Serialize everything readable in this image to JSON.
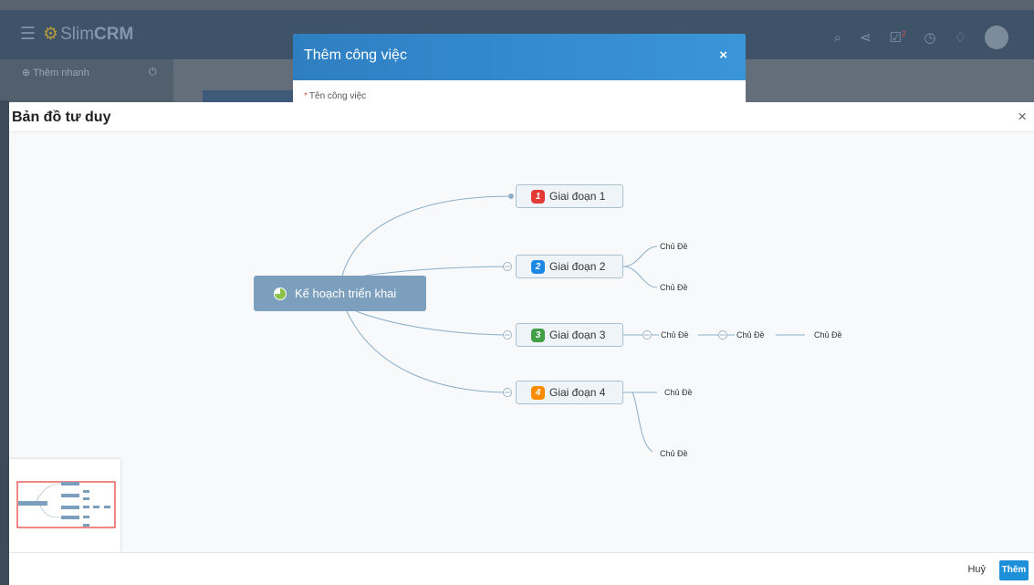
{
  "app": {
    "logo_prefix": "Slim",
    "logo_suffix": "CRM",
    "sidebar_quick": "Thêm nhanh",
    "notification_count": "2"
  },
  "task_dialog": {
    "title": "Thêm công việc",
    "close_label": "×",
    "field_label": "Tên công việc"
  },
  "mindmap": {
    "title": "Bản đồ tư duy",
    "close_label": "×",
    "root": "Kế hoạch triển khai",
    "stages": [
      {
        "num": "1",
        "label": "Giai đoạn 1",
        "color": "#e53935"
      },
      {
        "num": "2",
        "label": "Giai đoạn 2",
        "color": "#1e88e5"
      },
      {
        "num": "3",
        "label": "Giai đoạn 3",
        "color": "#43a047"
      },
      {
        "num": "4",
        "label": "Giai đoạn 4",
        "color": "#fb8c00"
      }
    ],
    "topic_label": "Chủ Đề",
    "cancel_label": "Huỷ",
    "add_label": "Thêm"
  },
  "colors": {
    "accent": "#1e8fd9",
    "node_border": "#a9c0d2",
    "edge": "#8aaec8",
    "root_bg": "#7c9fbd"
  }
}
